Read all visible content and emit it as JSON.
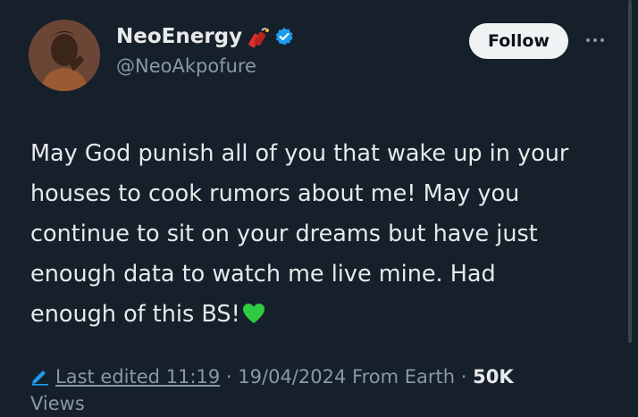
{
  "author": {
    "display_name": "NeoEnergy",
    "handle": "@NeoAkpofure",
    "badge_icon": "firecracker-icon",
    "verified_icon": "verified-badge-icon",
    "verified_color": "#1d9bf0"
  },
  "actions": {
    "follow_label": "Follow",
    "more_icon": "more-options-icon"
  },
  "tweet": {
    "lines": [
      "May God punish all of you that wake up in your",
      "houses to cook rumors about me! May you",
      "continue to sit on your dreams but have just",
      "enough data to watch me live mine. Had",
      "enough of this BS!"
    ],
    "end_emoji": "green-heart-icon"
  },
  "meta": {
    "edit_icon": "pencil-icon",
    "edited_label": "Last edited",
    "time": "11:19",
    "sep1": "·",
    "date": "19/04/2024",
    "source": "From Earth",
    "sep2": "·",
    "views_count": "50K",
    "views_label": "Views"
  },
  "colors": {
    "background": "#15202b",
    "text_primary": "#e7e9ea",
    "text_secondary": "#8b98a5",
    "accent": "#1d9bf0",
    "heart": "#2ecc40"
  }
}
